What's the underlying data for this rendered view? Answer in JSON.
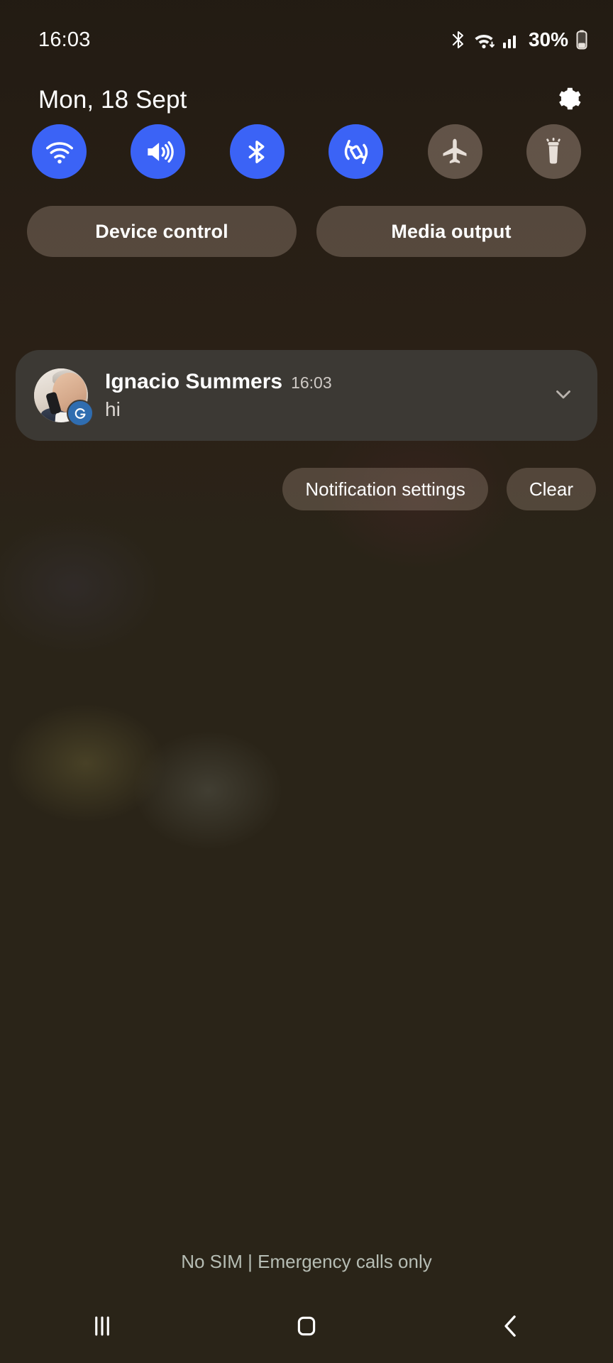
{
  "status_bar": {
    "clock": "16:03",
    "battery_percent": "30%",
    "icons": [
      "bluetooth-icon",
      "wifi-icon",
      "cellular-signal-icon",
      "battery-icon"
    ]
  },
  "shade_header": {
    "date": "Mon, 18 Sept",
    "settings_icon": "gear-icon"
  },
  "quick_toggles": [
    {
      "name": "wifi",
      "icon": "wifi-icon",
      "state": "on"
    },
    {
      "name": "sound",
      "icon": "volume-icon",
      "state": "on"
    },
    {
      "name": "bluetooth",
      "icon": "bluetooth-icon",
      "state": "on"
    },
    {
      "name": "auto-rotate",
      "icon": "auto-rotate-icon",
      "state": "on"
    },
    {
      "name": "airplane",
      "icon": "airplane-icon",
      "state": "off"
    },
    {
      "name": "flashlight",
      "icon": "flashlight-icon",
      "state": "off"
    }
  ],
  "control_row": {
    "device_control": "Device control",
    "media_output": "Media output"
  },
  "notification": {
    "title": "Ignacio Summers",
    "time": "16:03",
    "body": "hi",
    "expand_icon": "chevron-down-icon",
    "avatar": "contact-photo-man-on-phone",
    "app_badge": "messages-app-badge-icon"
  },
  "notification_actions": {
    "settings": "Notification settings",
    "clear": "Clear"
  },
  "bottom": {
    "carrier_status": "No SIM | Emergency calls only"
  },
  "nav_bar": [
    {
      "name": "recents",
      "icon": "recents-icon"
    },
    {
      "name": "home",
      "icon": "home-icon"
    },
    {
      "name": "back",
      "icon": "back-icon"
    }
  ],
  "colors": {
    "accent_on": "#3b63f6",
    "toggle_off": "rgba(180,160,145,.42)",
    "notification_bg": "rgba(62,58,54,.94)",
    "badge_blue": "#2f6db0"
  }
}
